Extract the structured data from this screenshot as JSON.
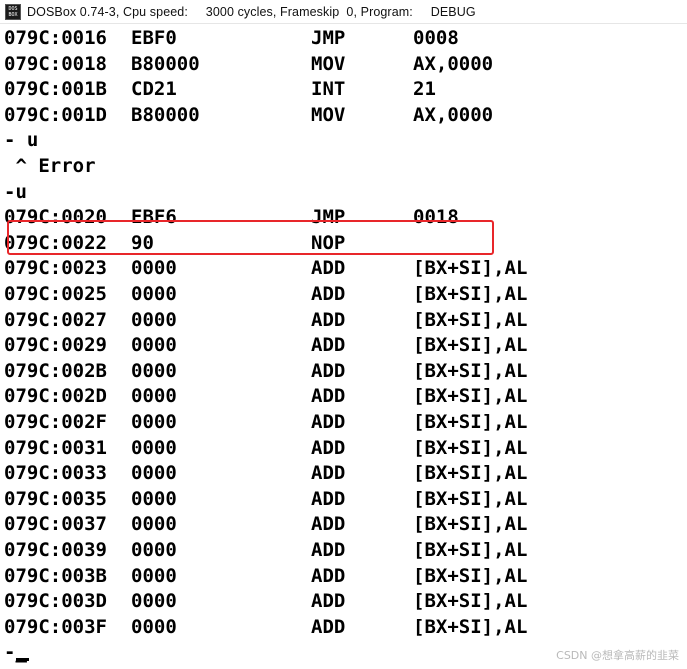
{
  "window": {
    "title": "DOSBox 0.74-3, Cpu speed:     3000 cycles, Frameskip  0, Program:     DEBUG",
    "icon_text_top": "DOS",
    "icon_text_bottom": "BOX"
  },
  "disasm_block_1": [
    {
      "addr": "079C:0016",
      "hex": "EBF0",
      "mnemonic": "JMP",
      "operand": "0008"
    },
    {
      "addr": "079C:0018",
      "hex": "B80000",
      "mnemonic": "MOV",
      "operand": "AX,0000"
    },
    {
      "addr": "079C:001B",
      "hex": "CD21",
      "mnemonic": "INT",
      "operand": "21"
    },
    {
      "addr": "079C:001D",
      "hex": "B80000",
      "mnemonic": "MOV",
      "operand": "AX,0000"
    }
  ],
  "commands": {
    "cmd_1": "- u",
    "error": " ^ Error",
    "cmd_2": "-u",
    "prompt": "-_"
  },
  "disasm_block_2": [
    {
      "addr": "079C:0020",
      "hex": "EBF6",
      "mnemonic": "JMP",
      "operand": "0018"
    },
    {
      "addr": "079C:0022",
      "hex": "90",
      "mnemonic": "NOP",
      "operand": ""
    },
    {
      "addr": "079C:0023",
      "hex": "0000",
      "mnemonic": "ADD",
      "operand": "[BX+SI],AL"
    },
    {
      "addr": "079C:0025",
      "hex": "0000",
      "mnemonic": "ADD",
      "operand": "[BX+SI],AL"
    },
    {
      "addr": "079C:0027",
      "hex": "0000",
      "mnemonic": "ADD",
      "operand": "[BX+SI],AL"
    },
    {
      "addr": "079C:0029",
      "hex": "0000",
      "mnemonic": "ADD",
      "operand": "[BX+SI],AL"
    },
    {
      "addr": "079C:002B",
      "hex": "0000",
      "mnemonic": "ADD",
      "operand": "[BX+SI],AL"
    },
    {
      "addr": "079C:002D",
      "hex": "0000",
      "mnemonic": "ADD",
      "operand": "[BX+SI],AL"
    },
    {
      "addr": "079C:002F",
      "hex": "0000",
      "mnemonic": "ADD",
      "operand": "[BX+SI],AL"
    },
    {
      "addr": "079C:0031",
      "hex": "0000",
      "mnemonic": "ADD",
      "operand": "[BX+SI],AL"
    },
    {
      "addr": "079C:0033",
      "hex": "0000",
      "mnemonic": "ADD",
      "operand": "[BX+SI],AL"
    },
    {
      "addr": "079C:0035",
      "hex": "0000",
      "mnemonic": "ADD",
      "operand": "[BX+SI],AL"
    },
    {
      "addr": "079C:0037",
      "hex": "0000",
      "mnemonic": "ADD",
      "operand": "[BX+SI],AL"
    },
    {
      "addr": "079C:0039",
      "hex": "0000",
      "mnemonic": "ADD",
      "operand": "[BX+SI],AL"
    },
    {
      "addr": "079C:003B",
      "hex": "0000",
      "mnemonic": "ADD",
      "operand": "[BX+SI],AL"
    },
    {
      "addr": "079C:003D",
      "hex": "0000",
      "mnemonic": "ADD",
      "operand": "[BX+SI],AL"
    },
    {
      "addr": "079C:003F",
      "hex": "0000",
      "mnemonic": "ADD",
      "operand": "[BX+SI],AL"
    }
  ],
  "annotation": {
    "highlight_color": "#e8262a"
  },
  "watermark": "CSDN @想拿高薪的韭菜"
}
